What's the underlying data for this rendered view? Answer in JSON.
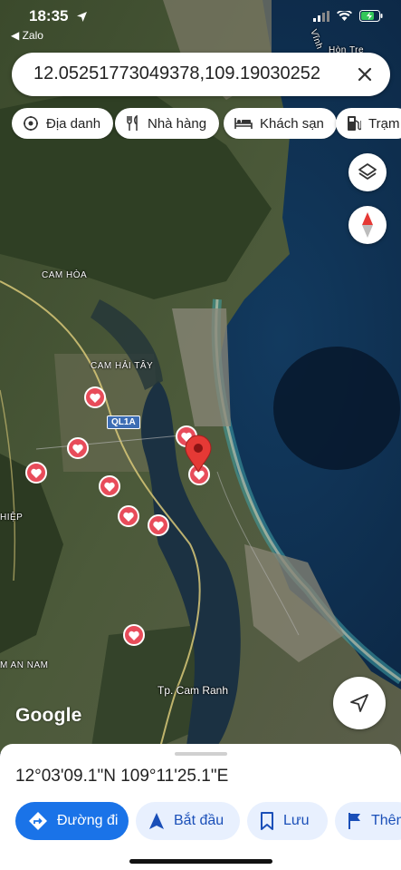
{
  "status_bar": {
    "time": "18:35",
    "back_app": "◀ Zalo"
  },
  "search": {
    "value": "12.05251773049378,109.19030252",
    "clear_icon": "close-icon"
  },
  "chips": [
    {
      "label": "Địa danh",
      "icon": "landmark-icon"
    },
    {
      "label": "Nhà hàng",
      "icon": "fork-knife-icon"
    },
    {
      "label": "Khách sạn",
      "icon": "bed-icon"
    },
    {
      "label": "Trạm",
      "icon": "gas-station-icon"
    }
  ],
  "map": {
    "labels": {
      "top_right": "Hòn Tre",
      "coast_top": "Vĩnh",
      "cam_hoa": "CAM HÒA",
      "cam_hai_tay": "CAM HẢI TÂY",
      "road": "QL1A",
      "hiep": "HIỆP",
      "cam_an_nam": "M AN NAM",
      "cam_ranh": "Tp. Cam Ranh"
    },
    "logo": "Google",
    "accent_color": "#e84c5a"
  },
  "sheet": {
    "coordinates": "12°03'09.1\"N 109°11'25.1\"E",
    "actions": [
      {
        "label": "Đường đi",
        "icon": "directions-icon"
      },
      {
        "label": "Bắt đầu",
        "icon": "navigation-arrow-icon"
      },
      {
        "label": "Lưu",
        "icon": "bookmark-icon"
      },
      {
        "label": "Thêm",
        "icon": "flag-icon"
      }
    ]
  }
}
